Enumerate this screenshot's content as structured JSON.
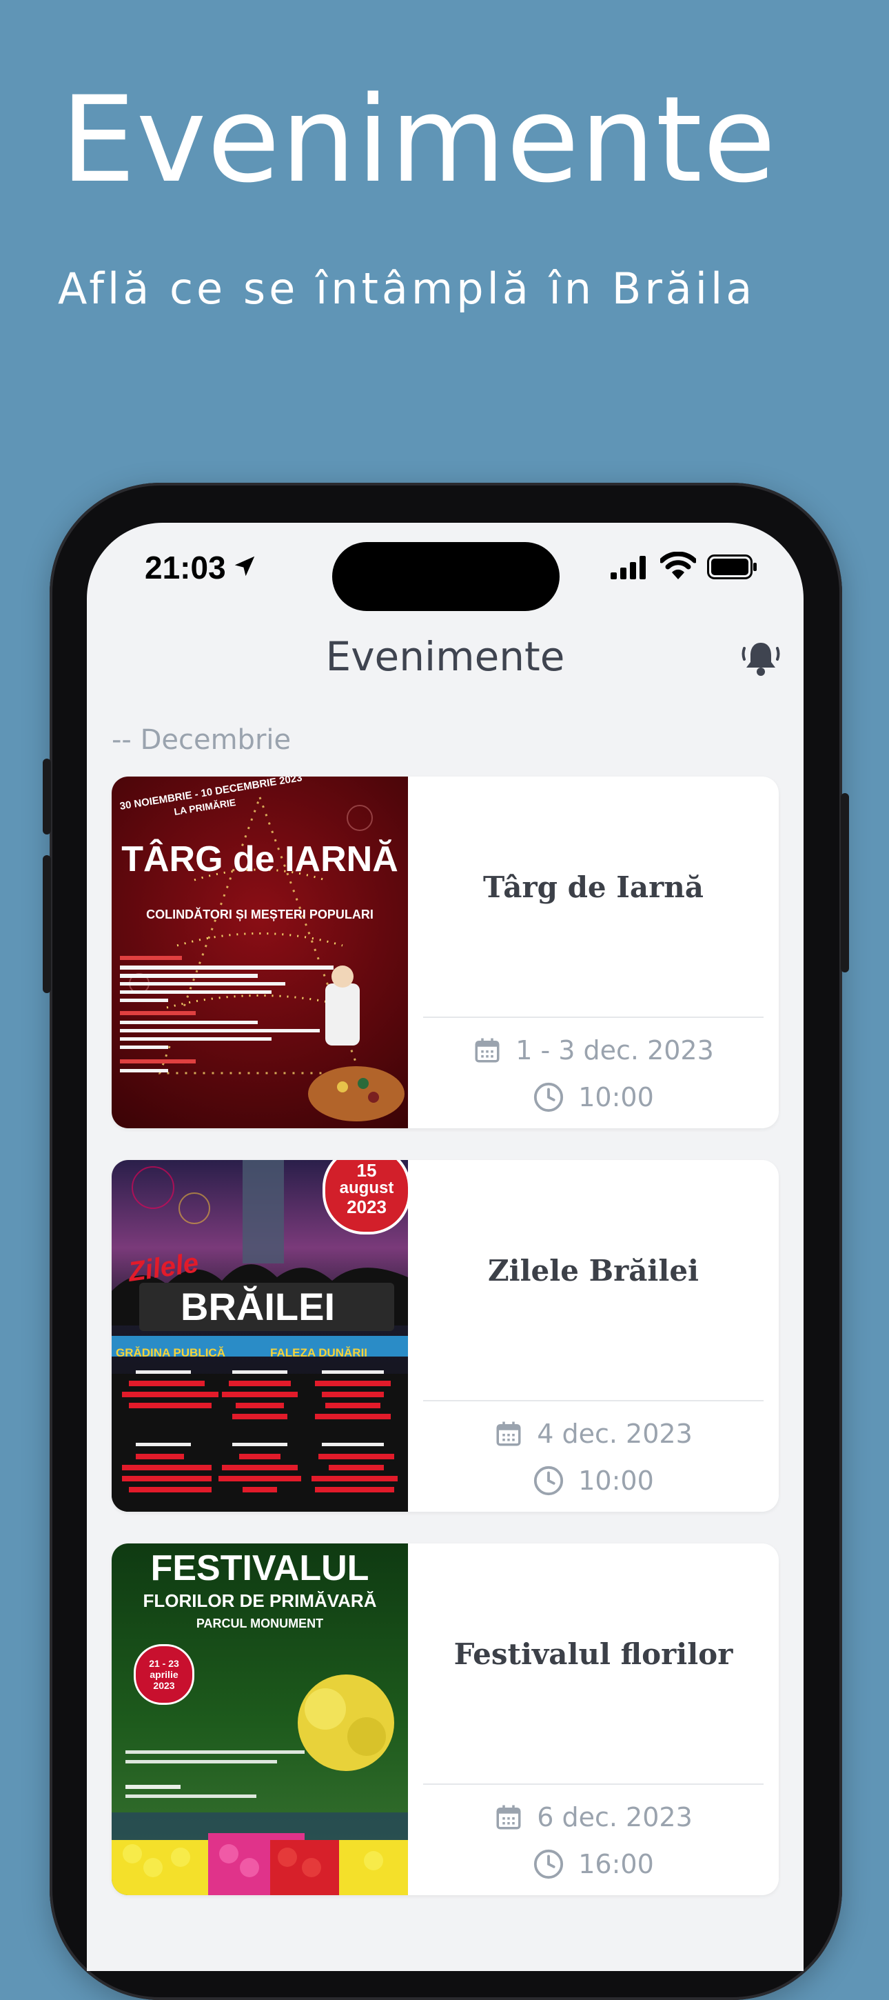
{
  "hero": {
    "title": "Evenimente",
    "subtitle": "Află ce se întâmplă în Brăila"
  },
  "status_bar": {
    "time": "21:03"
  },
  "nav": {
    "title": "Evenimente"
  },
  "section": {
    "label": "-- Decembrie"
  },
  "events": [
    {
      "title": "Târg de Iarnă",
      "date": "1 - 3 dec. 2023",
      "time": "10:00",
      "poster": {
        "top": "30 NOIEMBRIE - 10 DECEMBRIE 2023",
        "sub": "LA PRIMĂRIE",
        "headline": "TÂRG de IARNĂ",
        "tagline": "COLINDĂTORI ȘI MEȘTERI POPULARI"
      }
    },
    {
      "title": "Zilele Brăilei",
      "date": "4 dec. 2023",
      "time": "10:00",
      "poster": {
        "badge_day": "15",
        "badge_month": "august",
        "badge_year": "2023",
        "headline_small": "Zilele",
        "headline": "BRĂILEI",
        "col1": "GRĂDINA PUBLICĂ",
        "col2": "FALEZA DUNĂRII"
      }
    },
    {
      "title": "Festivalul florilor",
      "date": "6 dec. 2023",
      "time": "16:00",
      "poster": {
        "headline": "FESTIVALUL",
        "sub": "FLORILOR DE PRIMĂVARĂ",
        "place": "PARCUL MONUMENT",
        "badge": "21 - 23 aprilie 2023"
      }
    }
  ],
  "colors": {
    "background": "#6095b6",
    "screen": "#f2f3f5",
    "card": "#ffffff",
    "muted": "#9aa3ae",
    "title": "#3f4450"
  }
}
